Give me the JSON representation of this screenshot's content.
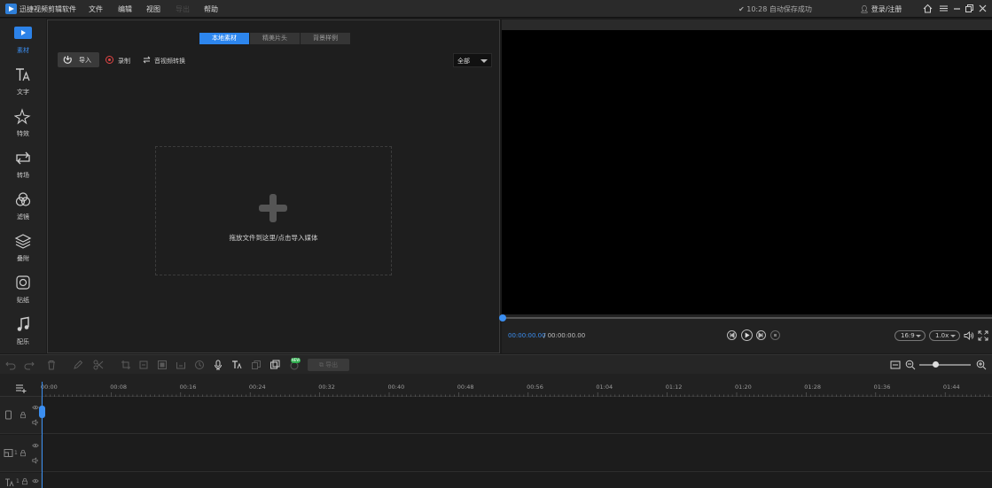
{
  "titlebar": {
    "app_title": "迅捷视频剪辑软件",
    "menus": [
      "文件",
      "编辑",
      "视图",
      "导出",
      "帮助"
    ],
    "autosave_text": "10:28 自动保存成功",
    "login_text": "登录/注册"
  },
  "sidebar": {
    "items": [
      {
        "label": "素材",
        "icon": "play-icon",
        "active": true
      },
      {
        "label": "文字",
        "icon": "text-icon"
      },
      {
        "label": "特效",
        "icon": "sparkle-icon"
      },
      {
        "label": "转场",
        "icon": "transition-icon"
      },
      {
        "label": "滤镜",
        "icon": "filter-icon"
      },
      {
        "label": "叠附",
        "icon": "layers-icon"
      },
      {
        "label": "贴纸",
        "icon": "sticker-icon"
      },
      {
        "label": "配乐",
        "icon": "music-icon"
      }
    ]
  },
  "media": {
    "tabs": [
      "本地素材",
      "精美片头",
      "背景样例"
    ],
    "import_label": "导入",
    "record_label": "录制",
    "convert_label": "音视频转换",
    "filter_value": "全部",
    "dropzone_text": "拖放文件到这里/点击导入媒体"
  },
  "preview": {
    "time_current": "00:00:00.00",
    "time_total": "/ 00:00:00.00",
    "ratio": "16:9",
    "speed": "1.0x"
  },
  "timeline": {
    "export_label": "导出",
    "new_badge": "NEW",
    "ticks": [
      "00:00",
      "00:08",
      "00:16",
      "00:24",
      "00:32",
      "00:40",
      "00:48",
      "00:56",
      "01:04",
      "01:12",
      "01:20",
      "01:28",
      "01:36",
      "01:44"
    ],
    "track_numbers": [
      "1",
      "1"
    ]
  },
  "colors": {
    "accent": "#2d86ee",
    "record": "#e04444",
    "new_badge": "#2fae4e"
  }
}
